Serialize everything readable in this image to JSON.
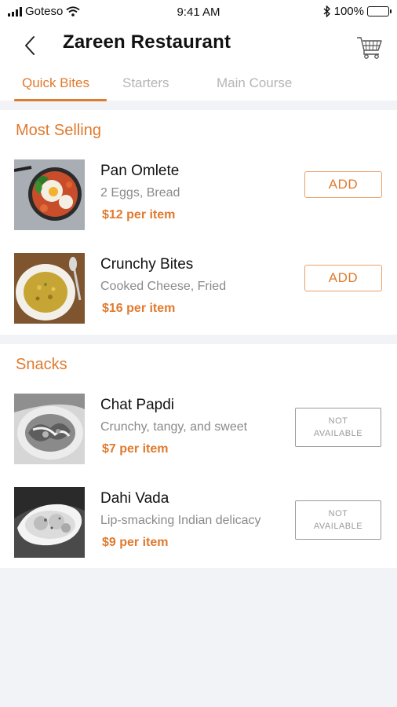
{
  "status_bar": {
    "carrier": "Goteso",
    "time": "9:41 AM",
    "battery": "100%"
  },
  "header": {
    "title": "Zareen Restaurant",
    "back_icon": "chevron-left-icon",
    "cart_icon": "shopping-cart-icon"
  },
  "tabs": [
    {
      "label": "Quick Bites",
      "active": true
    },
    {
      "label": "Starters",
      "active": false
    },
    {
      "label": "Main Course",
      "active": false
    }
  ],
  "sections": [
    {
      "title": "Most Selling",
      "items": [
        {
          "name": "Pan Omlete",
          "desc": "2 Eggs, Bread",
          "price": "$12 per item",
          "action": "ADD"
        },
        {
          "name": "Crunchy Bites",
          "desc": "Cooked Cheese, Fried",
          "price": "$16 per item",
          "action": "ADD"
        }
      ]
    },
    {
      "title": "Snacks",
      "items": [
        {
          "name": "Chat Papdi",
          "desc": "Crunchy, tangy, and sweet",
          "price": "$7 per item",
          "action_line1": "NOT",
          "action_line2": "AVAILABLE"
        },
        {
          "name": "Dahi Vada",
          "desc": "Lip-smacking Indian delicacy",
          "price": "$9 per item",
          "action_line1": "NOT",
          "action_line2": "AVAILABLE"
        }
      ]
    }
  ],
  "colors": {
    "accent": "#e07a2e",
    "muted": "#8a8a8a",
    "background": "#f2f3f7"
  }
}
